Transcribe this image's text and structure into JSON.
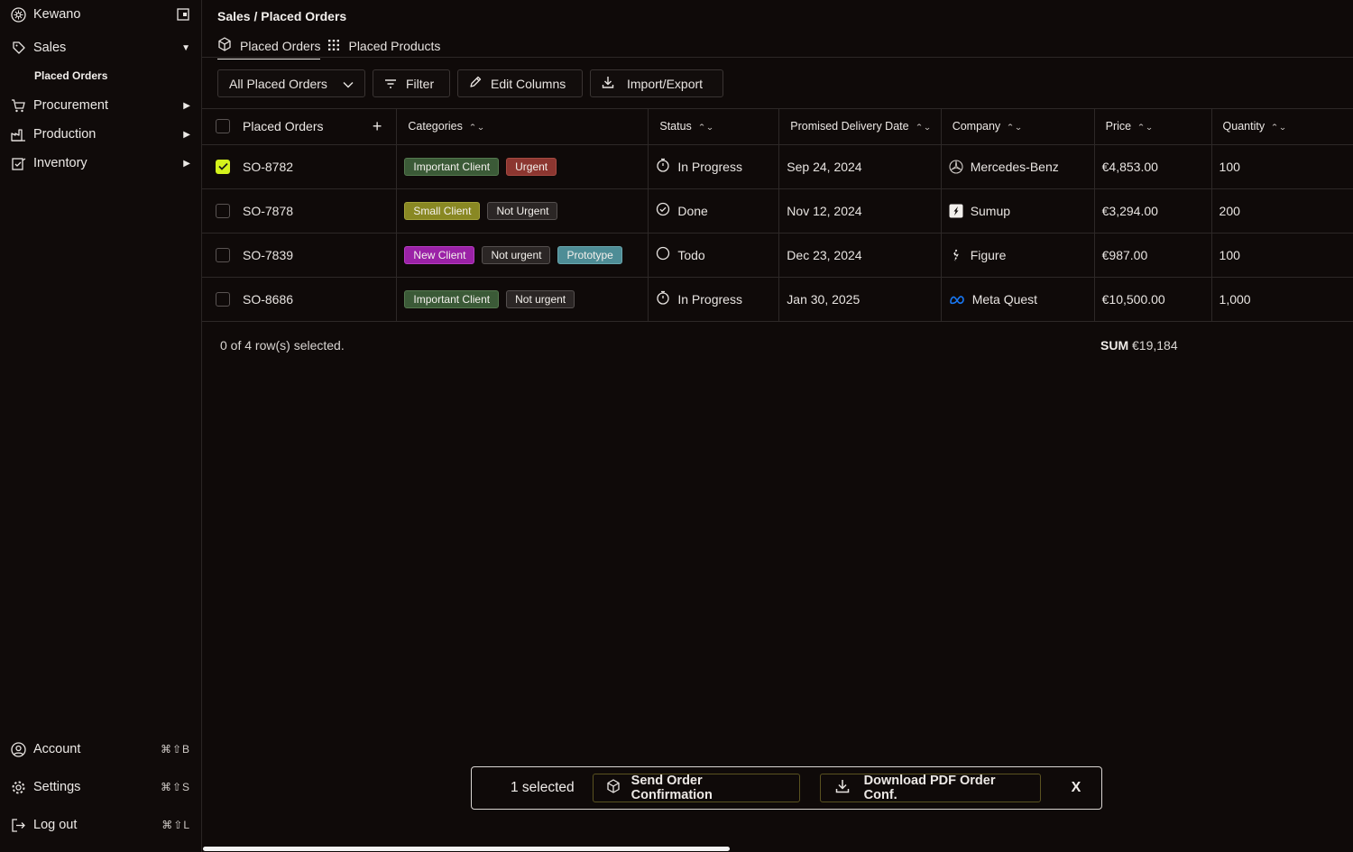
{
  "sidebar": {
    "brand": "Kewano",
    "sales": {
      "label": "Sales",
      "sub": "Placed Orders"
    },
    "procurement": "Procurement",
    "production": "Production",
    "inventory": "Inventory",
    "account": {
      "label": "Account",
      "shortcut": "⌘⇧B"
    },
    "settings": {
      "label": "Settings",
      "shortcut": "⌘⇧S"
    },
    "logout": {
      "label": "Log out",
      "shortcut": "⌘⇧L"
    }
  },
  "header": {
    "breadcrumb": "Sales / Placed Orders",
    "tabs": [
      "Placed Orders",
      "Placed Products"
    ]
  },
  "toolbar": {
    "view": "All Placed Orders",
    "filter": "Filter",
    "edit_columns": "Edit Columns",
    "import_export": "Import/Export"
  },
  "table": {
    "columns": [
      "Placed Orders",
      "Categories",
      "Status",
      "Promised Delivery Date",
      "Company",
      "Price",
      "Quantity"
    ],
    "rows": [
      {
        "checked": true,
        "id": "SO-8782",
        "tags": [
          {
            "label": "Important Client",
            "color": "green"
          },
          {
            "label": "Urgent",
            "color": "red"
          }
        ],
        "status": "In Progress",
        "status_icon": "stopwatch-icon",
        "date": "Sep 24, 2024",
        "company": "Mercedes-Benz",
        "company_icon": "mercedes-logo-icon",
        "price": "€4,853.00",
        "qty": "100"
      },
      {
        "checked": false,
        "id": "SO-7878",
        "tags": [
          {
            "label": "Small Client",
            "color": "olive"
          },
          {
            "label": "Not Urgent",
            "color": "gray"
          }
        ],
        "status": "Done",
        "status_icon": "check-circle-icon",
        "date": "Nov 12, 2024",
        "company": "Sumup",
        "company_icon": "sumup-logo-icon",
        "price": "€3,294.00",
        "qty": "200"
      },
      {
        "checked": false,
        "id": "SO-7839",
        "tags": [
          {
            "label": "New Client",
            "color": "purple"
          },
          {
            "label": "Not urgent",
            "color": "gray"
          },
          {
            "label": "Prototype",
            "color": "teal"
          }
        ],
        "status": "Todo",
        "status_icon": "circle-icon",
        "date": "Dec 23, 2024",
        "company": "Figure",
        "company_icon": "figure-logo-icon",
        "price": "€987.00",
        "qty": "100"
      },
      {
        "checked": false,
        "id": "SO-8686",
        "tags": [
          {
            "label": "Important Client",
            "color": "green"
          },
          {
            "label": "Not urgent",
            "color": "gray"
          }
        ],
        "status": "In Progress",
        "status_icon": "stopwatch-icon",
        "date": "Jan 30, 2025",
        "company": "Meta Quest",
        "company_icon": "meta-logo-icon",
        "price": "€10,500.00",
        "qty": "1,000"
      }
    ]
  },
  "footer": {
    "selection": "0 of 4 row(s) selected.",
    "sum_label": "SUM",
    "sum_value": "€19,184"
  },
  "action_bar": {
    "selected": "1 selected",
    "send": "Send Order Confirmation",
    "download": "Download PDF Order Conf.",
    "close": "X"
  },
  "colors": {
    "accent": "#d4f21c",
    "background": "#0f0a09",
    "meta_blue": "#1877f2"
  }
}
